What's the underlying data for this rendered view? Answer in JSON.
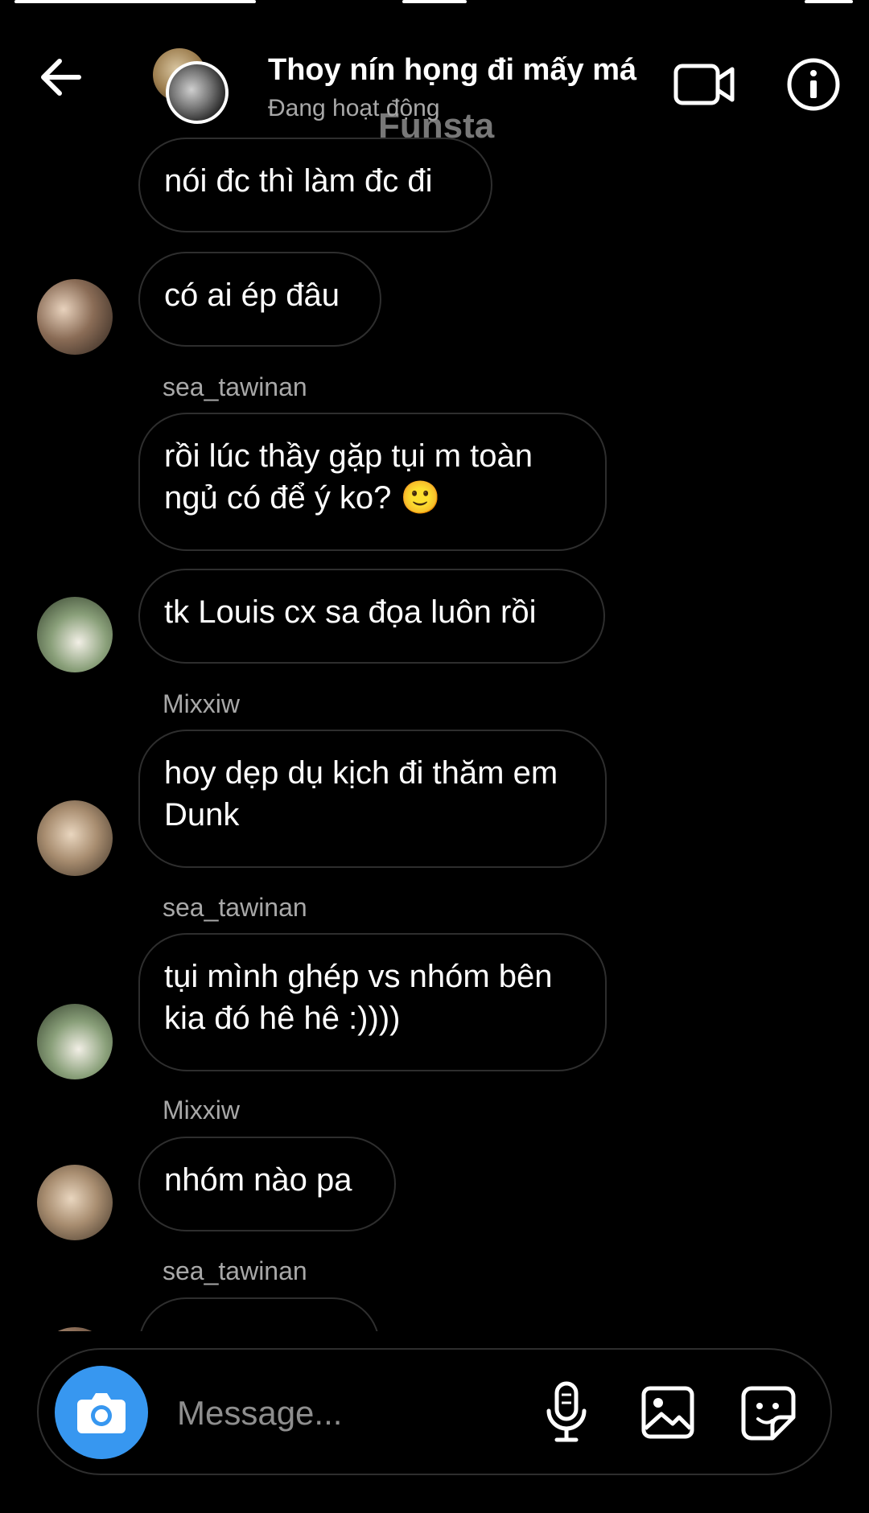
{
  "header": {
    "title": "Thoy nín họng đi mấy má",
    "status": "Đang hoạt động",
    "watermark": "Funsta",
    "back_icon": "arrow-left-icon",
    "video_icon": "video-camera-icon",
    "info_icon": "info-icon"
  },
  "messages": [
    {
      "text": "nói đc thì làm đc đi"
    },
    {
      "text": "có ai ép đâu"
    },
    {
      "sender": "sea_tawinan",
      "text": "rồi lúc thầy gặp tụi m toàn ngủ có để ý ko? 🙂"
    },
    {
      "text": "tk Louis cx sa đọa luôn rồi"
    },
    {
      "sender": "Mixxiw",
      "text": "hoy dẹp dụ kịch đi thăm em Dunk"
    },
    {
      "sender": "sea_tawinan",
      "text": "tụi mình ghép vs nhóm bên kia đó hê hê :))))"
    },
    {
      "sender": "Mixxiw",
      "text": "nhóm nào pa"
    },
    {
      "sender": "sea_tawinan"
    }
  ],
  "composer": {
    "placeholder": "Message...",
    "camera_icon": "camera-icon",
    "mic_icon": "microphone-icon",
    "gallery_icon": "image-icon",
    "sticker_icon": "sticker-icon"
  },
  "colors": {
    "background": "#000000",
    "bubble_border": "#2e2e2e",
    "accent": "#3797f0",
    "secondary_text": "#a8a8a8"
  }
}
